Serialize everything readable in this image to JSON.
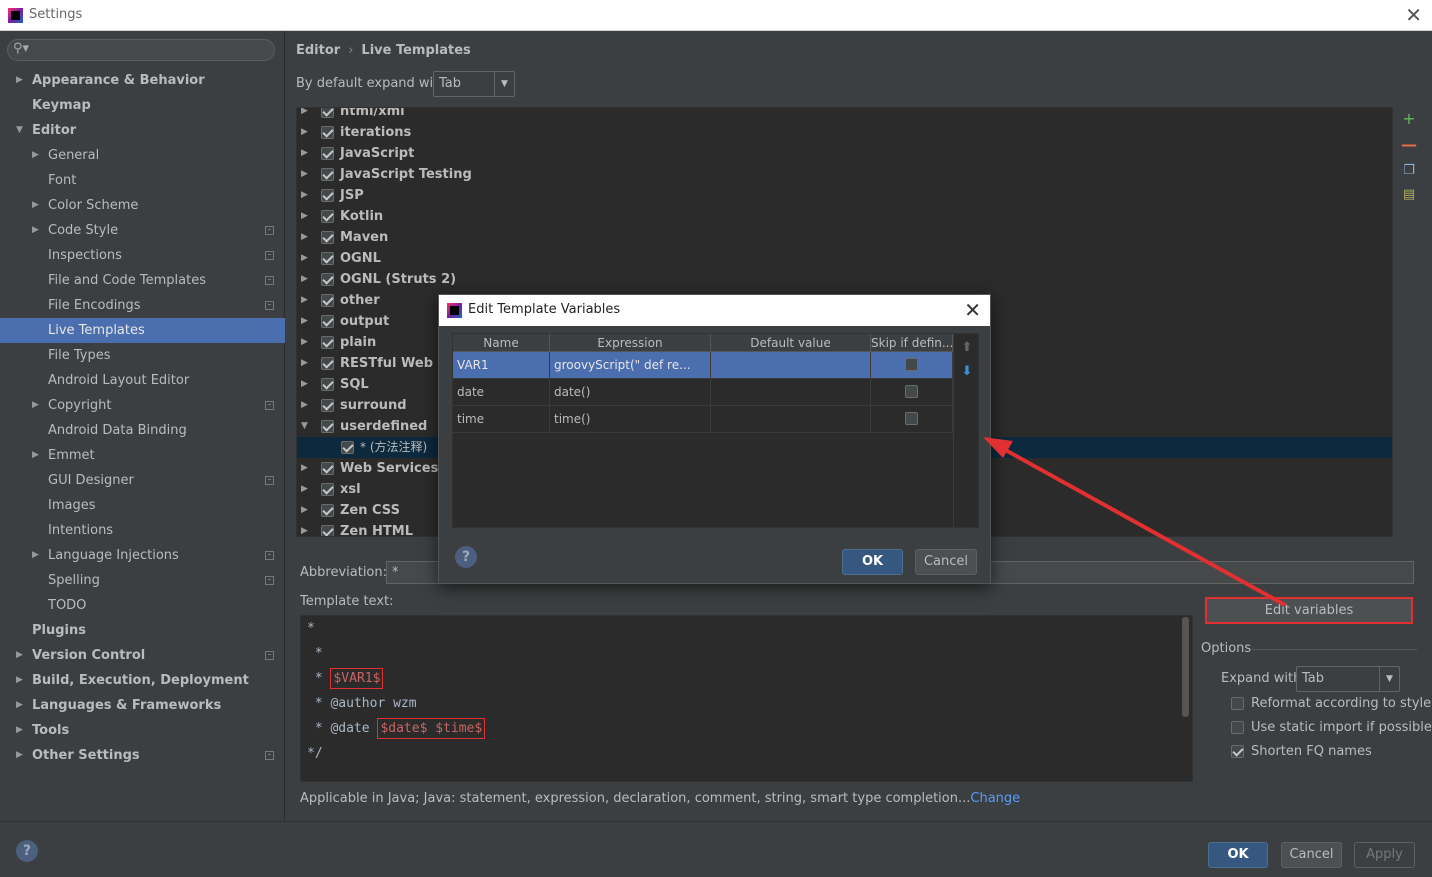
{
  "window": {
    "title": "Settings"
  },
  "search": {
    "placeholder": ""
  },
  "sidebar": {
    "items": [
      {
        "label": "Appearance & Behavior",
        "level": 0,
        "arrow": "right",
        "bold": true
      },
      {
        "label": "Keymap",
        "level": 0,
        "arrow": "none",
        "bold": true
      },
      {
        "label": "Editor",
        "level": 0,
        "arrow": "down",
        "bold": true
      },
      {
        "label": "General",
        "level": 1,
        "arrow": "right"
      },
      {
        "label": "Font",
        "level": 1,
        "arrow": "none"
      },
      {
        "label": "Color Scheme",
        "level": 1,
        "arrow": "right"
      },
      {
        "label": "Code Style",
        "level": 1,
        "arrow": "right",
        "proj": true
      },
      {
        "label": "Inspections",
        "level": 1,
        "arrow": "none",
        "proj": true
      },
      {
        "label": "File and Code Templates",
        "level": 1,
        "arrow": "none",
        "proj": true
      },
      {
        "label": "File Encodings",
        "level": 1,
        "arrow": "none",
        "proj": true
      },
      {
        "label": "Live Templates",
        "level": 1,
        "arrow": "none",
        "selected": true
      },
      {
        "label": "File Types",
        "level": 1,
        "arrow": "none"
      },
      {
        "label": "Android Layout Editor",
        "level": 1,
        "arrow": "none"
      },
      {
        "label": "Copyright",
        "level": 1,
        "arrow": "right",
        "proj": true
      },
      {
        "label": "Android Data Binding",
        "level": 1,
        "arrow": "none"
      },
      {
        "label": "Emmet",
        "level": 1,
        "arrow": "right"
      },
      {
        "label": "GUI Designer",
        "level": 1,
        "arrow": "none",
        "proj": true
      },
      {
        "label": "Images",
        "level": 1,
        "arrow": "none"
      },
      {
        "label": "Intentions",
        "level": 1,
        "arrow": "none"
      },
      {
        "label": "Language Injections",
        "level": 1,
        "arrow": "right",
        "proj": true
      },
      {
        "label": "Spelling",
        "level": 1,
        "arrow": "none",
        "proj": true
      },
      {
        "label": "TODO",
        "level": 1,
        "arrow": "none"
      },
      {
        "label": "Plugins",
        "level": 0,
        "arrow": "none",
        "bold": true
      },
      {
        "label": "Version Control",
        "level": 0,
        "arrow": "right",
        "bold": true,
        "proj": true
      },
      {
        "label": "Build, Execution, Deployment",
        "level": 0,
        "arrow": "right",
        "bold": true
      },
      {
        "label": "Languages & Frameworks",
        "level": 0,
        "arrow": "right",
        "bold": true
      },
      {
        "label": "Tools",
        "level": 0,
        "arrow": "right",
        "bold": true
      },
      {
        "label": "Other Settings",
        "level": 0,
        "arrow": "right",
        "bold": true,
        "proj": true
      }
    ]
  },
  "breadcrumb": {
    "part1": "Editor",
    "sep": "›",
    "part2": "Live Templates"
  },
  "expand_default": {
    "label": "By default expand with",
    "value": "Tab"
  },
  "template_groups": [
    {
      "label": "html/xml",
      "arrow": "right"
    },
    {
      "label": "iterations",
      "arrow": "right"
    },
    {
      "label": "JavaScript",
      "arrow": "right"
    },
    {
      "label": "JavaScript Testing",
      "arrow": "right"
    },
    {
      "label": "JSP",
      "arrow": "right"
    },
    {
      "label": "Kotlin",
      "arrow": "right"
    },
    {
      "label": "Maven",
      "arrow": "right"
    },
    {
      "label": "OGNL",
      "arrow": "right"
    },
    {
      "label": "OGNL (Struts 2)",
      "arrow": "right"
    },
    {
      "label": "other",
      "arrow": "right"
    },
    {
      "label": "output",
      "arrow": "right"
    },
    {
      "label": "plain",
      "arrow": "right"
    },
    {
      "label": "RESTful Web Se",
      "arrow": "right"
    },
    {
      "label": "SQL",
      "arrow": "right"
    },
    {
      "label": "surround",
      "arrow": "right"
    },
    {
      "label": "userdefined",
      "arrow": "down"
    },
    {
      "label": "* (方法注释)",
      "arrow": "none",
      "child": true,
      "selected": true
    },
    {
      "label": "Web Services",
      "arrow": "right"
    },
    {
      "label": "xsl",
      "arrow": "right"
    },
    {
      "label": "Zen CSS",
      "arrow": "right"
    },
    {
      "label": "Zen HTML",
      "arrow": "right"
    }
  ],
  "abbreviation": {
    "label": "Abbreviation:",
    "value": "*"
  },
  "template_text": {
    "label": "Template text:",
    "lines": [
      "*",
      " *",
      " * ",
      " * @author wzm",
      " * @date ",
      "*/"
    ],
    "var1": "$VAR1$",
    "date_time": "$date$ $time$"
  },
  "edit_variables": {
    "label": "Edit variables"
  },
  "options": {
    "label": "Options",
    "expand_label": "Expand with",
    "expand_value": "Tab",
    "items": [
      {
        "label": "Reformat according to style",
        "checked": false
      },
      {
        "label": "Use static import if possible",
        "checked": false
      },
      {
        "label": "Shorten FQ names",
        "checked": true
      }
    ]
  },
  "applicable": {
    "text": "Applicable in Java; Java: statement, expression, declaration, comment, string, smart type completion...",
    "link": "Change"
  },
  "dialog": {
    "title": "Edit Template Variables",
    "columns": [
      "Name",
      "Expression",
      "Default value",
      "Skip if defin..."
    ],
    "rows": [
      {
        "name": "VAR1",
        "expression": "groovyScript(\"     def re...",
        "default": "",
        "skip": false,
        "selected": true
      },
      {
        "name": "date",
        "expression": "date()",
        "default": "",
        "skip": false
      },
      {
        "name": "time",
        "expression": "time()",
        "default": "",
        "skip": false
      }
    ],
    "ok": "OK",
    "cancel": "Cancel",
    "help": "?"
  },
  "footer": {
    "help": "?",
    "ok": "OK",
    "cancel": "Cancel",
    "apply": "Apply"
  },
  "colors": {
    "selection": "#4b6eaf",
    "annotation": "#e03030",
    "link": "#589df6"
  }
}
